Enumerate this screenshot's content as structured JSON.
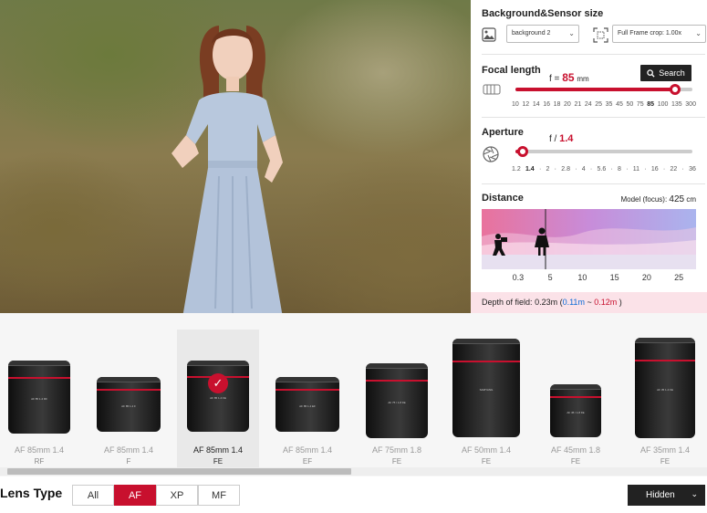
{
  "panel": {
    "bg_sensor": {
      "title": "Background&Sensor size",
      "background_select": "background 2",
      "sensor_select": "Full Frame crop: 1.00x"
    },
    "focal": {
      "title": "Focal length",
      "prefix": "f =",
      "value": "85",
      "unit": "mm",
      "search_label": "Search",
      "ticks": [
        "10",
        "12",
        "14",
        "16",
        "18",
        "20",
        "21",
        "24",
        "25",
        "35",
        "45",
        "50",
        "75",
        "85",
        "100",
        "135",
        "300"
      ],
      "selected_tick": "85",
      "slider_level": 0.9
    },
    "aperture": {
      "title": "Aperture",
      "prefix": "f /",
      "value": "1.4",
      "ticks": [
        "1.2",
        "1.4",
        "·",
        "2",
        "·",
        "2.8",
        "·",
        "4",
        "·",
        "5.6",
        "·",
        "8",
        "·",
        "11",
        "·",
        "16",
        "·",
        "22",
        "·",
        "36"
      ],
      "selected_tick": "1.4",
      "slider_level": 0.04
    },
    "distance": {
      "title": "Distance",
      "model_label": "Model (focus):",
      "model_value": "425",
      "model_unit": "cm",
      "ticks": [
        "0.3",
        "5",
        "10",
        "15",
        "20",
        "25"
      ]
    },
    "dof": {
      "label": "Depth of field:",
      "total": "0.23m",
      "open": "(",
      "near": "0.11m",
      "sep": "~",
      "far": "0.12m",
      "close": ")"
    }
  },
  "lenses": [
    {
      "name": "AF 85mm 1.4",
      "mount": "RF",
      "brand": "AF 85 1.4 RF",
      "selected": false
    },
    {
      "name": "AF 85mm 1.4",
      "mount": "F",
      "brand": "AF 85 1.4 F",
      "selected": false
    },
    {
      "name": "AF 85mm 1.4",
      "mount": "FE",
      "brand": "AF 85 1.4 FE",
      "selected": true
    },
    {
      "name": "AF 85mm 1.4",
      "mount": "EF",
      "brand": "AF 85 1.4 EF",
      "selected": false
    },
    {
      "name": "AF 75mm 1.8",
      "mount": "FE",
      "brand": "AF 75 / 1.8 FE",
      "selected": false
    },
    {
      "name": "AF 50mm 1.4",
      "mount": "FE",
      "brand": "SAMYANG",
      "selected": false
    },
    {
      "name": "AF 45mm 1.8",
      "mount": "FE",
      "brand": "AF 45 / 1.8 FE",
      "selected": false
    },
    {
      "name": "AF 35mm 1.4",
      "mount": "FE",
      "brand": "AF 35 1.4 FE",
      "selected": false
    }
  ],
  "lens_type": {
    "title": "Lens Type",
    "options": [
      "All",
      "AF",
      "XP",
      "MF"
    ],
    "active": "AF"
  },
  "hidden_button": "Hidden",
  "colors": {
    "accent": "#c8102e",
    "blue": "#0a6ad6",
    "dark": "#222222"
  },
  "icons": [
    "image-icon",
    "crop-icon",
    "lens-barrel-icon",
    "search-icon",
    "aperture-icon",
    "photographer-icon",
    "model-icon",
    "check-icon",
    "chevron-down-icon"
  ]
}
